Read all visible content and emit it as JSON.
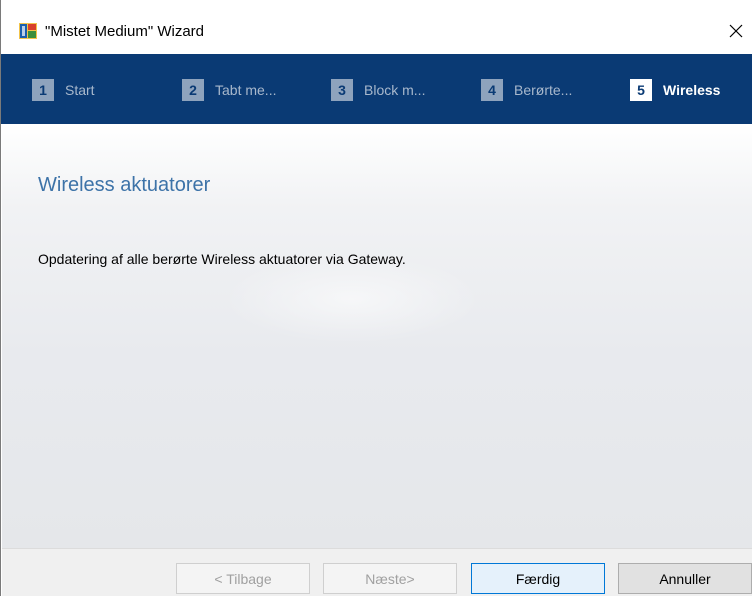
{
  "window": {
    "title": "\"Mistet Medium\" Wizard",
    "icon": "wizard-app-icon",
    "close_icon": "close-icon"
  },
  "steps": [
    {
      "number": "1",
      "label": "Start",
      "active": false
    },
    {
      "number": "2",
      "label": "Tabt me...",
      "active": false
    },
    {
      "number": "3",
      "label": "Block m...",
      "active": false
    },
    {
      "number": "4",
      "label": "Berørte...",
      "active": false
    },
    {
      "number": "5",
      "label": "Wireless",
      "active": true
    }
  ],
  "content": {
    "heading": "Wireless aktuatorer",
    "description": "Opdatering af alle berørte Wireless aktuatorer via Gateway."
  },
  "buttons": {
    "back": "< Tilbage",
    "next": "Næste>",
    "finish": "Færdig",
    "cancel": "Annuller"
  },
  "colors": {
    "stepbar": "#0a3a74",
    "heading": "#3d73a8",
    "default_button_border": "#0078d7"
  }
}
